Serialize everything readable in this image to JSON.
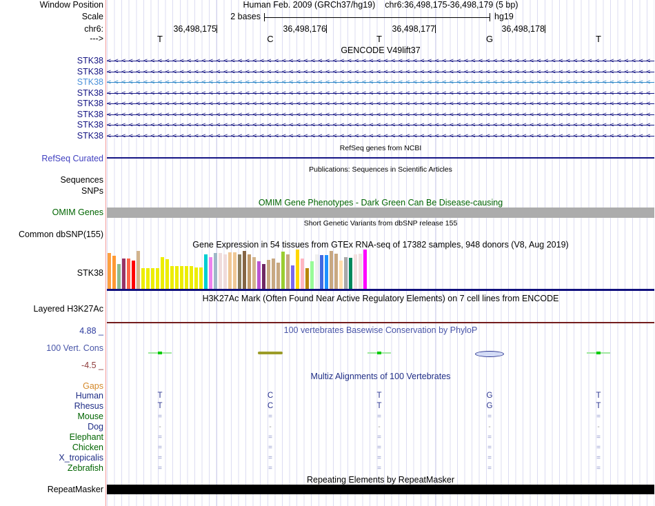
{
  "colors": {
    "navy": "#141483",
    "gene-highlight": "#2D87C8",
    "gene-highlight-label": "#4A90D9",
    "refseq-label": "#4040C0",
    "green": "#006400",
    "grid": "#DCDCF2",
    "grid-major": "#C6C6E6",
    "red-line": "#F49999",
    "maroon": "#731C1C",
    "phylop-title": "#4855A8",
    "phylop-max": "#2B3A9E",
    "phylop-min": "#8E3B3B",
    "multiz-title": "#1F2D86",
    "species-navy": "#1F2D86",
    "gaps-orange": "#D4882A",
    "align-mark": "#8890C8",
    "gtex-baseline": "#10107E",
    "omim-bar": "#ACACAC"
  },
  "header": {
    "window_position_label": "Window Position",
    "assembly": "Human Feb. 2009 (GRCh37/hg19)",
    "position": "chr6:36,498,175-36,498,179 (5 bp)",
    "scale_label": "Scale",
    "scale_value": "2 bases",
    "scale_assembly": "hg19",
    "chrom_label": "chr6:",
    "direction": "--->",
    "coordinates": [
      "36,498,175",
      "36,498,176",
      "36,498,177",
      "36,498,178"
    ],
    "bases": [
      "T",
      "C",
      "T",
      "G",
      "T"
    ]
  },
  "tracks": {
    "gencode": {
      "title": "GENCODE V49lift37",
      "arrow_char": "<",
      "genes": [
        {
          "label": "STK38",
          "highlight": false
        },
        {
          "label": "STK38",
          "highlight": false
        },
        {
          "label": "STK38",
          "highlight": true
        },
        {
          "label": "STK38",
          "highlight": false
        },
        {
          "label": "STK38",
          "highlight": false
        },
        {
          "label": "STK38",
          "highlight": false
        },
        {
          "label": "STK38",
          "highlight": false
        },
        {
          "label": "STK38",
          "highlight": false
        }
      ]
    },
    "refseq": {
      "title": "RefSeq genes from NCBI",
      "label": "RefSeq Curated"
    },
    "publications": {
      "title": "Publications: Sequences in Scientific Articles",
      "labels": [
        "Sequences",
        "SNPs"
      ]
    },
    "omim": {
      "title": "OMIM Gene Phenotypes - Dark Green Can Be Disease-causing",
      "label": "OMIM Genes"
    },
    "dbsnp": {
      "title": "Short Genetic Variants from dbSNP release 155",
      "label": "Common dbSNP(155)"
    },
    "gtex": {
      "title": "Gene Expression in 54 tissues from GTEx RNA-seq of 17382 samples, 948 donors (V8, Aug 2019)",
      "label": "STK38",
      "bars": [
        {
          "h": 52,
          "c": "#FFA040"
        },
        {
          "h": 48,
          "c": "#FF9933"
        },
        {
          "h": 36,
          "c": "#8FBC8F"
        },
        {
          "h": 44,
          "c": "#993366"
        },
        {
          "h": 44,
          "c": "#FF6347"
        },
        {
          "h": 41,
          "c": "#FF0000"
        },
        {
          "h": 55,
          "c": "#D2B48C"
        },
        {
          "h": 30,
          "c": "#EDED00"
        },
        {
          "h": 30,
          "c": "#EDED00"
        },
        {
          "h": 30,
          "c": "#EDED00"
        },
        {
          "h": 30,
          "c": "#EDED00"
        },
        {
          "h": 46,
          "c": "#EDED00"
        },
        {
          "h": 43,
          "c": "#EDED00"
        },
        {
          "h": 33,
          "c": "#EDED00"
        },
        {
          "h": 33,
          "c": "#EDED00"
        },
        {
          "h": 33,
          "c": "#EDED00"
        },
        {
          "h": 33,
          "c": "#EDED00"
        },
        {
          "h": 33,
          "c": "#EDED00"
        },
        {
          "h": 31,
          "c": "#EDED00"
        },
        {
          "h": 31,
          "c": "#EDED00"
        },
        {
          "h": 50,
          "c": "#00CED1"
        },
        {
          "h": 46,
          "c": "#EE82EE"
        },
        {
          "h": 52,
          "c": "#9FB8C8"
        },
        {
          "h": 52,
          "c": "#F0DCDC"
        },
        {
          "h": 50,
          "c": "#F0DCDC"
        },
        {
          "h": 53,
          "c": "#F0C896"
        },
        {
          "h": 53,
          "c": "#F0C896"
        },
        {
          "h": 50,
          "c": "#8B7D5C"
        },
        {
          "h": 55,
          "c": "#856545"
        },
        {
          "h": 50,
          "c": "#C19A6B"
        },
        {
          "h": 46,
          "c": "#D2B48C"
        },
        {
          "h": 40,
          "c": "#BA55D3"
        },
        {
          "h": 36,
          "c": "#702963"
        },
        {
          "h": 42,
          "c": "#C8A882"
        },
        {
          "h": 44,
          "c": "#C8A882"
        },
        {
          "h": 38,
          "c": "#C8A882"
        },
        {
          "h": 54,
          "c": "#9ACD32"
        },
        {
          "h": 50,
          "c": "#C8A882"
        },
        {
          "h": 34,
          "c": "#7B68EE"
        },
        {
          "h": 57,
          "c": "#FFD700"
        },
        {
          "h": 44,
          "c": "#FFB6C1"
        },
        {
          "h": 30,
          "c": "#B8860B"
        },
        {
          "h": 40,
          "c": "#98FB98"
        },
        {
          "h": 50,
          "c": "#F0F0F0"
        },
        {
          "h": 49,
          "c": "#4169E1"
        },
        {
          "h": 49,
          "c": "#1E90FF"
        },
        {
          "h": 55,
          "c": "#C8A882"
        },
        {
          "h": 51,
          "c": "#C8A882"
        },
        {
          "h": 41,
          "c": "#FFDEAD"
        },
        {
          "h": 46,
          "c": "#A9A9A9"
        },
        {
          "h": 45,
          "c": "#00885C"
        },
        {
          "h": 50,
          "c": "#F2E0E0"
        },
        {
          "h": 51,
          "c": "#F2E0E0"
        },
        {
          "h": 57,
          "c": "#FF00FF"
        }
      ]
    },
    "h3k27ac": {
      "title": "H3K27Ac Mark (Often Found Near Active Regulatory Elements) on 7 cell lines from ENCODE",
      "label": "Layered H3K27Ac"
    },
    "phylop": {
      "title": "100 vertebrates Basewise Conservation by PhyloP",
      "label": "100 Vert. Cons",
      "max": "4.88 _",
      "min": "-4.5 _",
      "marks": [
        {
          "type": "green"
        },
        {
          "type": "olive"
        },
        {
          "type": "green"
        },
        {
          "type": "blue"
        },
        {
          "type": "green"
        }
      ]
    },
    "multiz": {
      "title": "Multiz Alignments of 100 Vertebrates",
      "species": [
        {
          "name": "Gaps",
          "color": "orange",
          "cells": [
            "",
            "",
            "",
            "",
            ""
          ]
        },
        {
          "name": "Human",
          "color": "navy",
          "cells": [
            "T",
            "C",
            "T",
            "G",
            "T"
          ]
        },
        {
          "name": "Rhesus",
          "color": "navy",
          "cells": [
            "T",
            "C",
            "T",
            "G",
            "T"
          ]
        },
        {
          "name": "Mouse",
          "color": "green",
          "cells": [
            "=",
            "=",
            "=",
            "=",
            "="
          ]
        },
        {
          "name": "Dog",
          "color": "navy",
          "cells": [
            "-",
            "-",
            "-",
            "-",
            "-"
          ]
        },
        {
          "name": "Elephant",
          "color": "green",
          "cells": [
            "=",
            "=",
            "=",
            "=",
            "="
          ]
        },
        {
          "name": "Chicken",
          "color": "green",
          "cells": [
            "=",
            "=",
            "=",
            "=",
            "="
          ]
        },
        {
          "name": "X_tropicalis",
          "color": "navy",
          "cells": [
            "=",
            "=",
            "=",
            "=",
            "="
          ]
        },
        {
          "name": "Zebrafish",
          "color": "green",
          "cells": [
            "=",
            "=",
            "=",
            "=",
            "="
          ]
        }
      ]
    },
    "repeatmasker": {
      "title": "Repeating Elements by RepeatMasker",
      "label": "RepeatMasker"
    }
  }
}
